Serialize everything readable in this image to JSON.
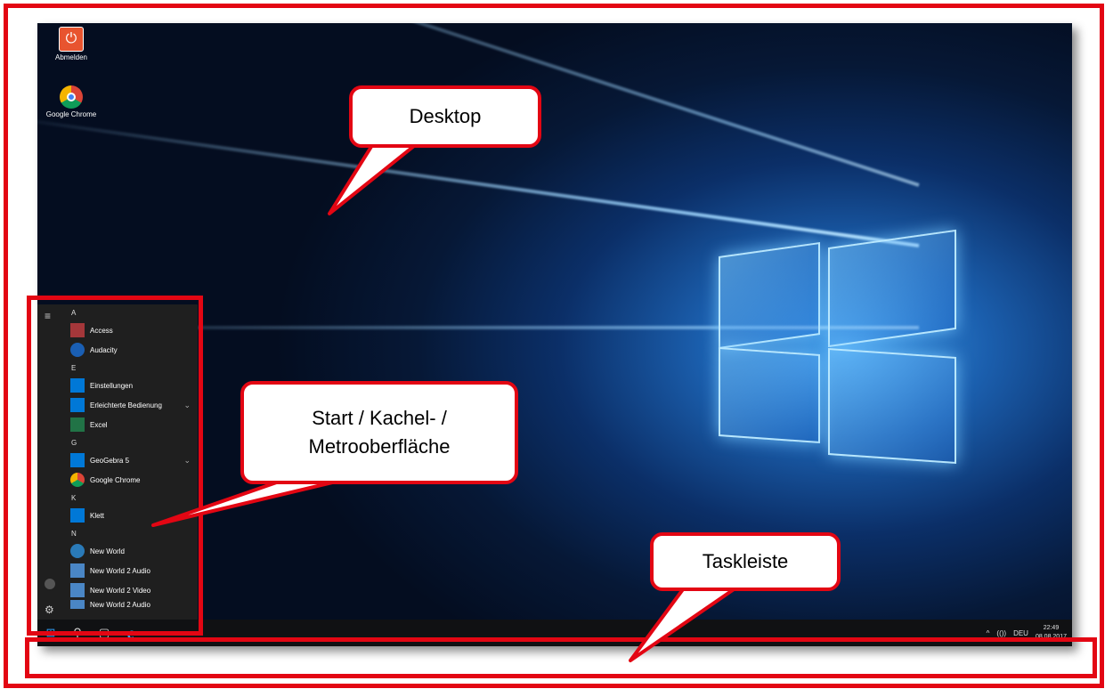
{
  "desktop": {
    "icons": [
      {
        "label": "Abmelden",
        "icon": "power-icon"
      },
      {
        "label": "Google Chrome",
        "icon": "chrome-icon"
      }
    ]
  },
  "start_menu": {
    "groups": [
      {
        "letter": "A",
        "apps": [
          {
            "label": "Access",
            "color": "#a4373a",
            "icon": "access-icon"
          },
          {
            "label": "Audacity",
            "color": "#1a5fb4",
            "icon": "audacity-icon"
          }
        ]
      },
      {
        "letter": "E",
        "apps": [
          {
            "label": "Einstellungen",
            "color": "#0078d7",
            "icon": "gear-icon"
          },
          {
            "label": "Erleichterte Bedienung",
            "color": "#0078d7",
            "icon": "folder-icon",
            "expand": "⌄"
          },
          {
            "label": "Excel",
            "color": "#217346",
            "icon": "excel-icon"
          }
        ]
      },
      {
        "letter": "G",
        "apps": [
          {
            "label": "GeoGebra 5",
            "color": "#0078d7",
            "icon": "folder-icon",
            "expand": "⌄"
          },
          {
            "label": "Google Chrome",
            "color": "#1f1f1f",
            "icon": "chrome-icon"
          }
        ]
      },
      {
        "letter": "K",
        "apps": [
          {
            "label": "Klett",
            "color": "#0078d7",
            "icon": "folder-icon",
            "expand": "⌄"
          }
        ]
      },
      {
        "letter": "N",
        "apps": [
          {
            "label": "New World",
            "color": "#2a7ab8",
            "icon": "globe-icon"
          },
          {
            "label": "New World 2 Audio",
            "color": "#4a86c5",
            "icon": "new-world-audio-icon"
          },
          {
            "label": "New World 2 Video",
            "color": "#4a86c5",
            "icon": "new-world-video-icon"
          },
          {
            "label": "New World 2 Audio",
            "color": "#4a86c5",
            "icon": "new-world-audio-icon"
          }
        ]
      }
    ]
  },
  "taskbar": {
    "tray": {
      "chevron": "^",
      "volume": "(())",
      "language": "DEU",
      "time": "22:49",
      "date": "08.08.2017"
    }
  },
  "callouts": {
    "desktop": "Desktop",
    "start_line1": "Start / Kachel- /",
    "start_line2": "Metrooberfläche",
    "taskbar": "Taskleiste"
  },
  "colors": {
    "annotation_red": "#e30613",
    "taskbar": "#101113",
    "start_bg": "#1f1f1f"
  }
}
